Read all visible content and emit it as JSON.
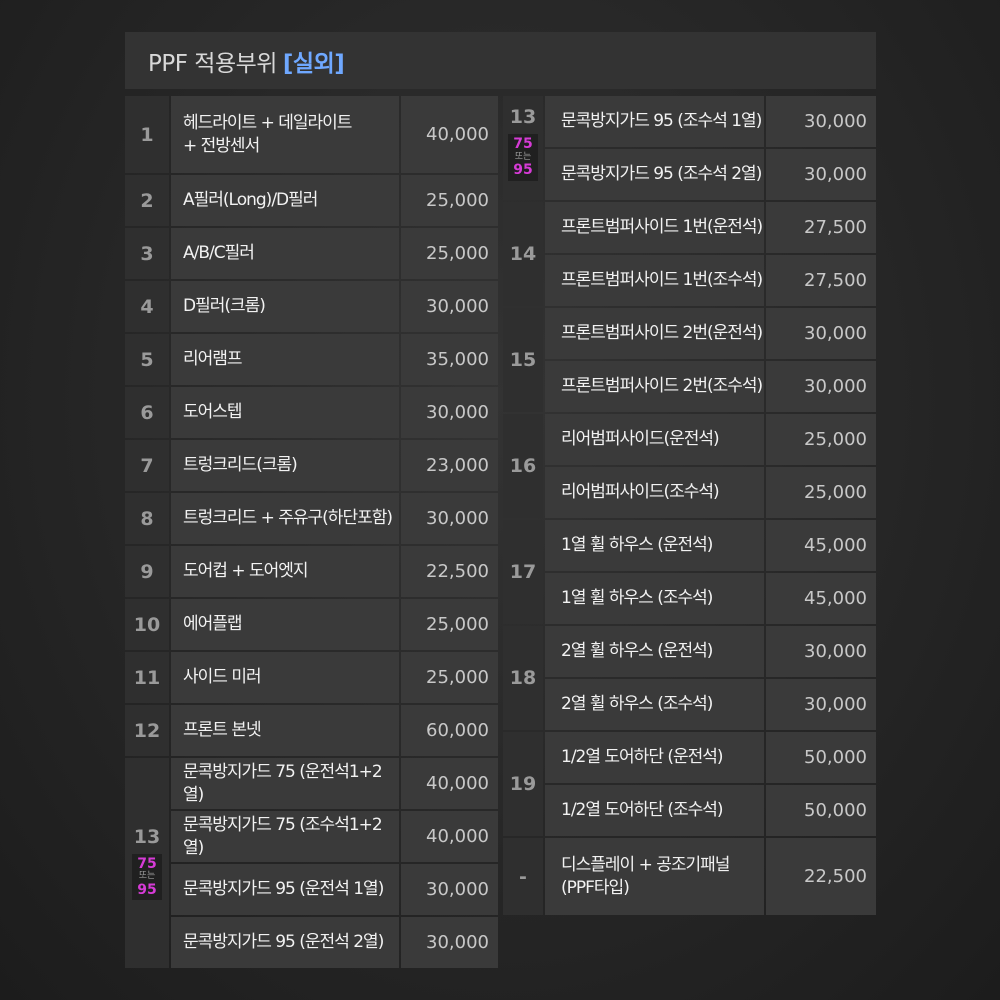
{
  "header": {
    "title": "PPF 적용부위",
    "accent": "[실외]"
  },
  "pill": {
    "top": "75",
    "or": "또는",
    "bottom": "95"
  },
  "left": [
    {
      "num": "1",
      "rows": [
        {
          "label": "헤드라이트 + 데일라이트\n+ 전방센서",
          "price": "40,000",
          "tall": true
        }
      ]
    },
    {
      "num": "2",
      "rows": [
        {
          "label": "A필러(Long)/D필러",
          "price": "25,000"
        }
      ]
    },
    {
      "num": "3",
      "rows": [
        {
          "label": "A/B/C필러",
          "price": "25,000"
        }
      ]
    },
    {
      "num": "4",
      "rows": [
        {
          "label": "D필러(크롬)",
          "price": "30,000"
        }
      ]
    },
    {
      "num": "5",
      "rows": [
        {
          "label": "리어램프",
          "price": "35,000"
        }
      ]
    },
    {
      "num": "6",
      "rows": [
        {
          "label": "도어스텝",
          "price": "30,000"
        }
      ]
    },
    {
      "num": "7",
      "rows": [
        {
          "label": "트렁크리드(크롬)",
          "price": "23,000"
        }
      ]
    },
    {
      "num": "8",
      "rows": [
        {
          "label": "트렁크리드 + 주유구(하단포함)",
          "price": "30,000"
        }
      ]
    },
    {
      "num": "9",
      "rows": [
        {
          "label": "도어컵 + 도어엣지",
          "price": "22,500"
        }
      ]
    },
    {
      "num": "10",
      "rows": [
        {
          "label": "에어플랩",
          "price": "25,000"
        }
      ]
    },
    {
      "num": "11",
      "rows": [
        {
          "label": "사이드 미러",
          "price": "25,000"
        }
      ]
    },
    {
      "num": "12",
      "rows": [
        {
          "label": "프론트 본넷",
          "price": "60,000"
        }
      ]
    },
    {
      "num": "13",
      "pill": true,
      "rows": [
        {
          "label": "문콕방지가드 75 (운전석1+2열)",
          "price": "40,000"
        },
        {
          "label": "문콕방지가드 75 (조수석1+2열)",
          "price": "40,000"
        },
        {
          "label": "문콕방지가드 95 (운전석 1열)",
          "price": "30,000"
        },
        {
          "label": "문콕방지가드 95 (운전석 2열)",
          "price": "30,000"
        }
      ]
    }
  ],
  "right": [
    {
      "num": "13",
      "pill": true,
      "top": true,
      "rows": [
        {
          "label": "문콕방지가드 95 (조수석 1열)",
          "price": "30,000"
        },
        {
          "label": "문콕방지가드 95 (조수석 2열)",
          "price": "30,000"
        }
      ]
    },
    {
      "num": "14",
      "rows": [
        {
          "label": "프론트범퍼사이드 1번(운전석)",
          "price": "27,500"
        },
        {
          "label": "프론트범퍼사이드 1번(조수석)",
          "price": "27,500"
        }
      ]
    },
    {
      "num": "15",
      "rows": [
        {
          "label": "프론트범퍼사이드 2번(운전석)",
          "price": "30,000"
        },
        {
          "label": "프론트범퍼사이드 2번(조수석)",
          "price": "30,000"
        }
      ]
    },
    {
      "num": "16",
      "rows": [
        {
          "label": "리어범퍼사이드(운전석)",
          "price": "25,000"
        },
        {
          "label": "리어범퍼사이드(조수석)",
          "price": "25,000"
        }
      ]
    },
    {
      "num": "17",
      "rows": [
        {
          "label": "1열 휠 하우스 (운전석)",
          "price": "45,000"
        },
        {
          "label": "1열 휠 하우스 (조수석)",
          "price": "45,000"
        }
      ]
    },
    {
      "num": "18",
      "rows": [
        {
          "label": "2열 휠 하우스 (운전석)",
          "price": "30,000"
        },
        {
          "label": "2열 휠 하우스 (조수석)",
          "price": "30,000"
        }
      ]
    },
    {
      "num": "19",
      "rows": [
        {
          "label": "1/2열 도어하단 (운전석)",
          "price": "50,000"
        },
        {
          "label": "1/2열 도어하단 (조수석)",
          "price": "50,000"
        }
      ]
    },
    {
      "num": "-",
      "rows": [
        {
          "label": "디스플레이 + 공조기패널\n(PPF타입)",
          "price": "22,500",
          "tall": true
        }
      ]
    }
  ]
}
